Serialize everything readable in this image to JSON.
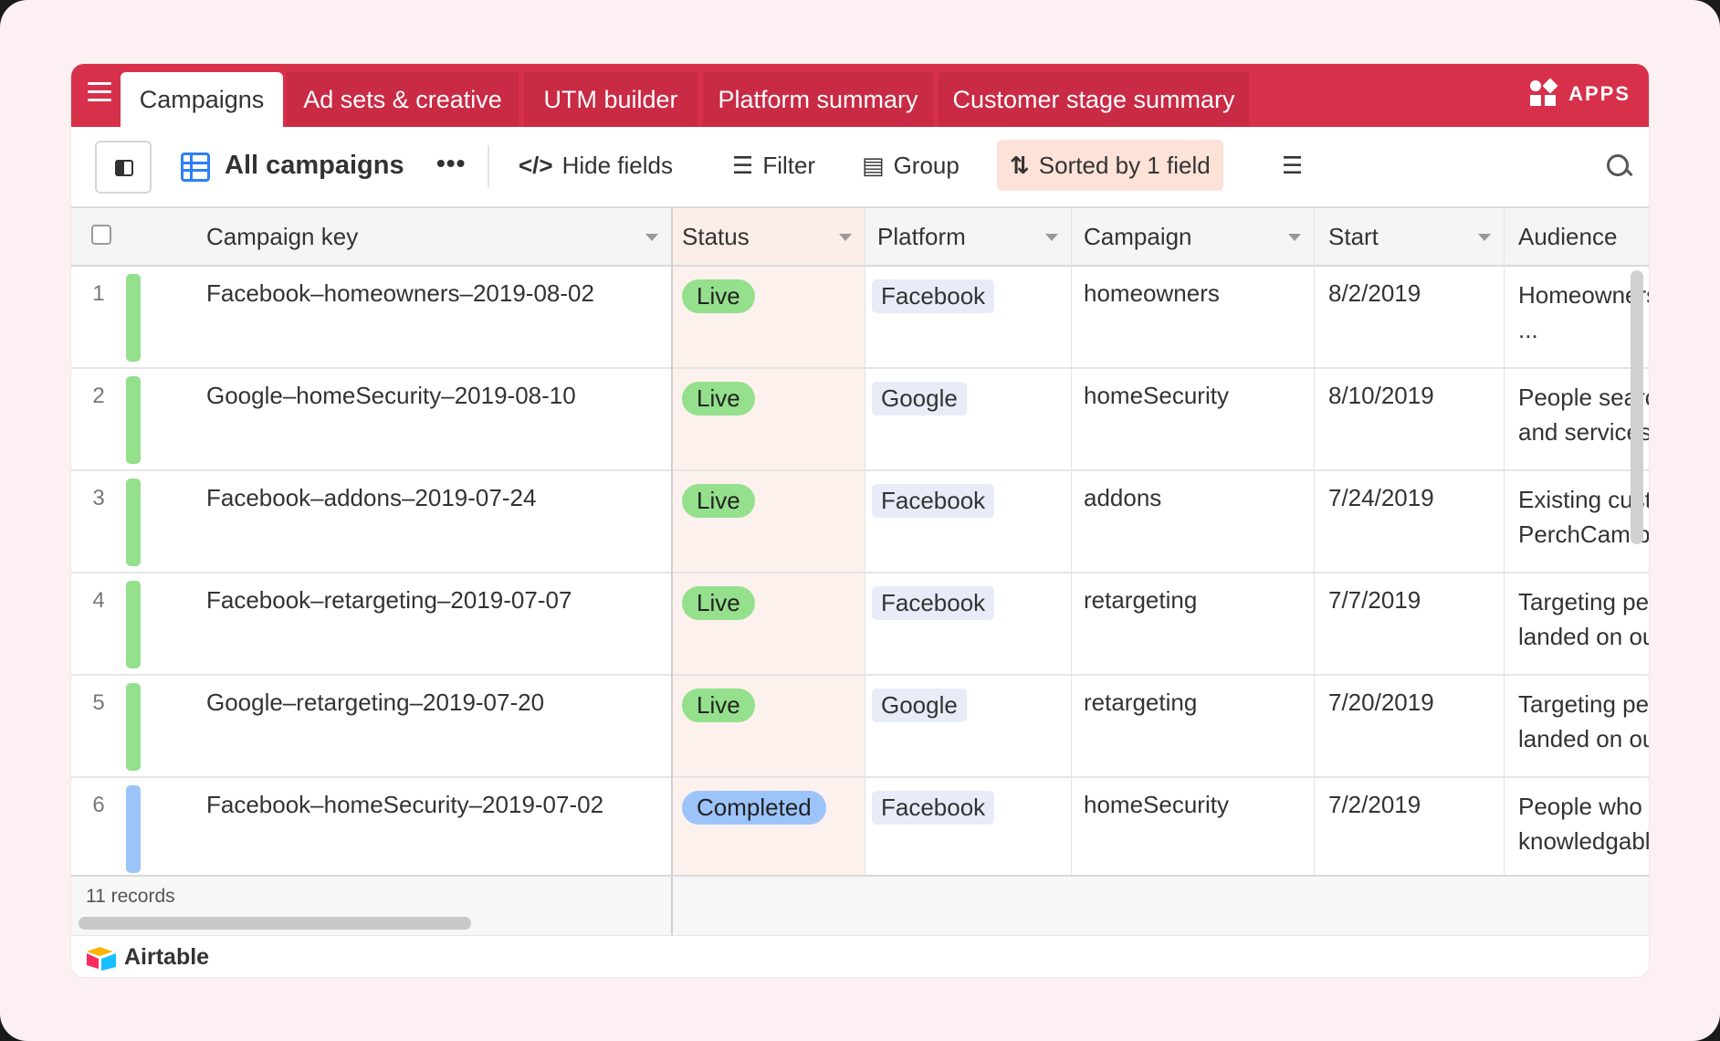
{
  "tabs": [
    {
      "label": "Campaigns",
      "active": true
    },
    {
      "label": "Ad sets & creative",
      "active": false
    },
    {
      "label": "UTM builder",
      "active": false
    },
    {
      "label": "Platform summary",
      "active": false
    },
    {
      "label": "Customer stage summary",
      "active": false
    }
  ],
  "apps_label": "APPS",
  "toolbar": {
    "view_name": "All campaigns",
    "more": "•••",
    "hide_fields": "Hide fields",
    "filter": "Filter",
    "group": "Group",
    "sorted": "Sorted by 1 field"
  },
  "columns": [
    "Campaign key",
    "Status",
    "Platform",
    "Campaign",
    "Start",
    "Audience"
  ],
  "rows": [
    {
      "num": "1",
      "key": "Facebook–homeowners–2019-08-02",
      "status": "Live",
      "platform": "Facebook",
      "campaign": "homeowners",
      "start": "8/2/2019",
      "audience1": "Homeowners",
      "audience2": "..."
    },
    {
      "num": "2",
      "key": "Google–homeSecurity–2019-08-10",
      "status": "Live",
      "platform": "Google",
      "campaign": "homeSecurity",
      "start": "8/10/2019",
      "audience1": "People searching",
      "audience2": "and services"
    },
    {
      "num": "3",
      "key": "Facebook–addons–2019-07-24",
      "status": "Live",
      "platform": "Facebook",
      "campaign": "addons",
      "start": "7/24/2019",
      "audience1": "Existing customers",
      "audience2": "PerchCam b"
    },
    {
      "num": "4",
      "key": "Facebook–retargeting–2019-07-07",
      "status": "Live",
      "platform": "Facebook",
      "campaign": "retargeting",
      "start": "7/7/2019",
      "audience1": "Targeting people",
      "audience2": "landed on our"
    },
    {
      "num": "5",
      "key": "Google–retargeting–2019-07-20",
      "status": "Live",
      "platform": "Google",
      "campaign": "retargeting",
      "start": "7/20/2019",
      "audience1": "Targeting people",
      "audience2": "landed on our"
    },
    {
      "num": "6",
      "key": "Facebook–homeSecurity–2019-07-02",
      "status": "Completed",
      "platform": "Facebook",
      "campaign": "homeSecurity",
      "start": "7/2/2019",
      "audience1": "People who",
      "audience2": "knowledgable"
    }
  ],
  "status_colors": {
    "Live": "#94e08c",
    "Completed": "#9cc4fb"
  },
  "bar_colors": {
    "Live": "#94e08c",
    "Completed": "#9cc4fb"
  },
  "footer": {
    "records": "11 records",
    "brand": "Airtable"
  }
}
